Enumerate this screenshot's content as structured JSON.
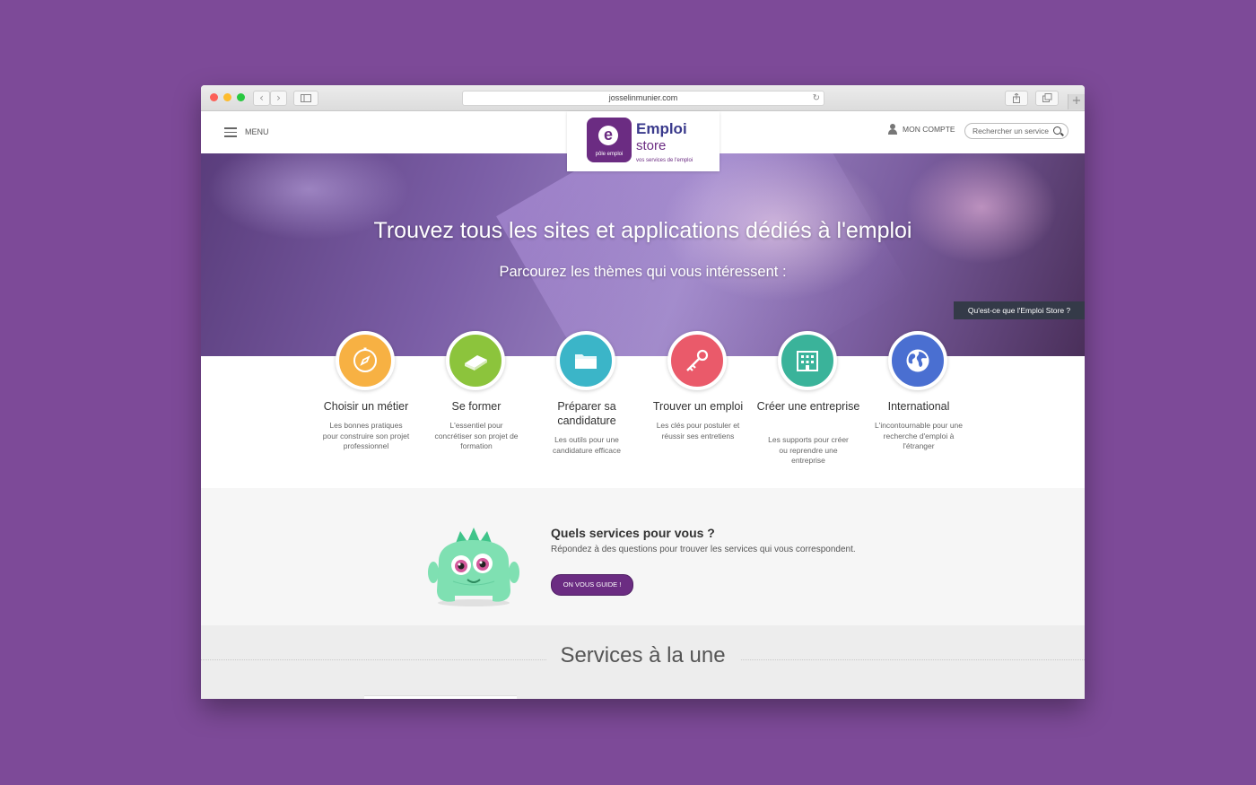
{
  "browser": {
    "url": "josselinmunier.com",
    "new_tab_icon": "plus-icon"
  },
  "header": {
    "menu_label": "MENU",
    "logo": {
      "mark_letter": "e",
      "mark_text": "pôle emploi",
      "name_line1": "Emploi",
      "name_line2": "store",
      "tagline": "vos services de l'emploi"
    },
    "account_label": "MON COMPTE",
    "search_placeholder": "Rechercher un service"
  },
  "hero": {
    "title": "Trouvez tous les sites et applications dédiés à l'emploi",
    "subtitle": "Parcourez les thèmes qui vous intéressent :",
    "about_link": "Qu'est-ce que l'Emploi Store ?"
  },
  "themes": [
    {
      "title": "Choisir un métier",
      "desc": "Les bonnes pratiques pour construire son projet professionnel",
      "color": "#f7b143",
      "icon": "compass-icon"
    },
    {
      "title": "Se former",
      "desc": "L'essentiel pour concrétiser son projet de formation",
      "color": "#8cc43c",
      "icon": "book-icon"
    },
    {
      "title": "Préparer sa candidature",
      "desc": "Les outils pour une candidature efficace",
      "color": "#3bb5c8",
      "icon": "folder-icon"
    },
    {
      "title": "Trouver un emploi",
      "desc": "Les clés pour postuler et réussir ses entretiens",
      "color": "#ea5a6a",
      "icon": "key-icon"
    },
    {
      "title": "Créer une entreprise",
      "desc": "Les supports pour créer ou reprendre une entreprise",
      "color": "#3ab39a",
      "icon": "building-icon"
    },
    {
      "title": "International",
      "desc": "L'incontournable pour une recherche d'emploi à l'étranger",
      "color": "#4a6fd1",
      "icon": "globe-icon"
    }
  ],
  "guide": {
    "title": "Quels services pour vous ?",
    "desc": "Répondez à des questions pour trouver les services qui vous correspondent.",
    "button": "ON VOUS GUIDE !"
  },
  "featured": {
    "title": "Services à la une"
  },
  "colors": {
    "background": "#7d4a98",
    "brand": "#6b2c82",
    "brand_blue": "#3a3a8c"
  }
}
